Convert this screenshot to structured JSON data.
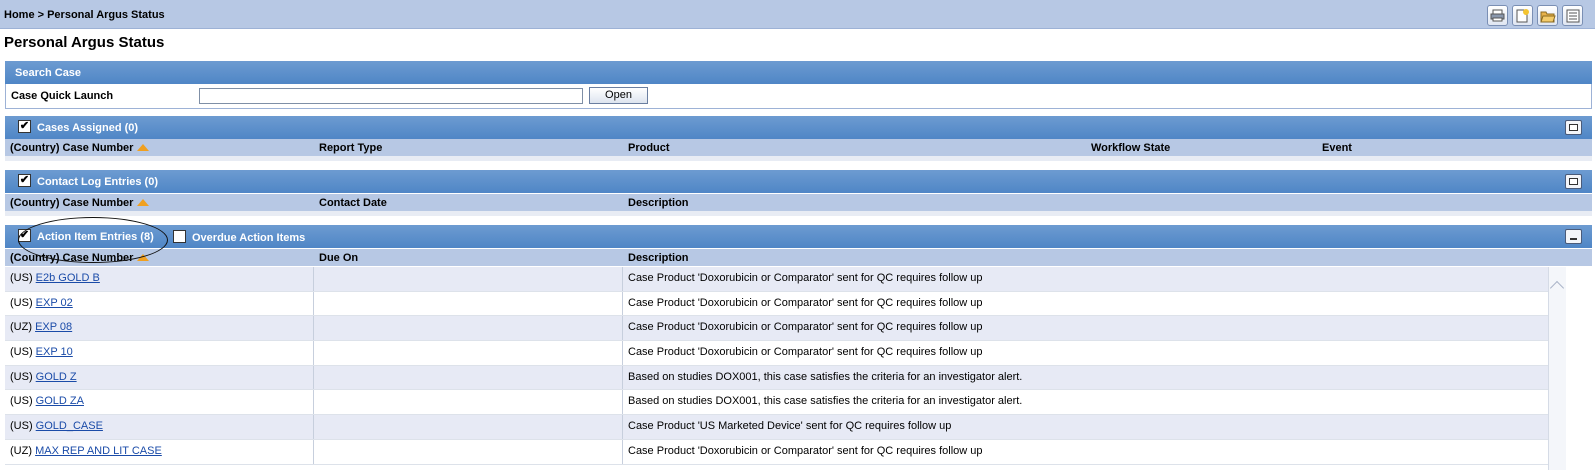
{
  "breadcrumb": "Home > Personal Argus Status",
  "page_title": "Personal Argus Status",
  "toolbar_icons": [
    "print-icon",
    "new-document-icon",
    "open-folder-icon",
    "list-icon"
  ],
  "search": {
    "header": "Search Case",
    "label": "Case Quick Launch",
    "value": "",
    "placeholder": "",
    "open_label": "Open"
  },
  "cases_assigned": {
    "title": "Cases Assigned (0)",
    "checked": true,
    "columns": [
      "(Country) Case Number",
      "Report Type",
      "Product",
      "Workflow State",
      "Event"
    ]
  },
  "contact_log": {
    "title": "Contact Log Entries (0)",
    "checked": true,
    "columns": [
      "(Country) Case Number",
      "Contact Date",
      "Description"
    ]
  },
  "action_items": {
    "title": "Action Item Entries (8)",
    "checked": true,
    "overdue_label": "Overdue Action Items",
    "overdue_checked": false,
    "columns": [
      "(Country) Case Number",
      "Due On",
      "Description"
    ],
    "rows": [
      {
        "country": "(US)",
        "case": "E2b GOLD B",
        "due": "",
        "description": "Case Product 'Doxorubicin or Comparator' sent for QC requires follow up"
      },
      {
        "country": "(US)",
        "case": "EXP 02",
        "due": "",
        "description": "Case Product 'Doxorubicin or Comparator' sent for QC requires follow up"
      },
      {
        "country": "(UZ)",
        "case": "EXP 08",
        "due": "",
        "description": "Case Product 'Doxorubicin or Comparator' sent for QC requires follow up"
      },
      {
        "country": "(US)",
        "case": "EXP 10",
        "due": "",
        "description": "Case Product 'Doxorubicin or Comparator' sent for QC requires follow up"
      },
      {
        "country": "(US)",
        "case": "GOLD Z",
        "due": "",
        "description": "Based on studies DOX001, this case satisfies the criteria for an investigator alert."
      },
      {
        "country": "(US)",
        "case": "GOLD ZA",
        "due": "",
        "description": "Based on studies DOX001, this case satisfies the criteria for an investigator alert."
      },
      {
        "country": "(US)",
        "case": "GOLD_CASE",
        "due": "",
        "description": "Case Product 'US Marketed Device' sent for QC requires follow up"
      },
      {
        "country": "(UZ)",
        "case": "MAX REP AND LIT CASE",
        "due": "",
        "description": "Case Product 'Doxorubicin or Comparator' sent for QC requires follow up"
      }
    ]
  },
  "colors": {
    "header_blue": "#4f86c6",
    "column_header": "#b7c8e4",
    "link": "#1a4ba8",
    "sort_arrow": "#f0a020"
  }
}
